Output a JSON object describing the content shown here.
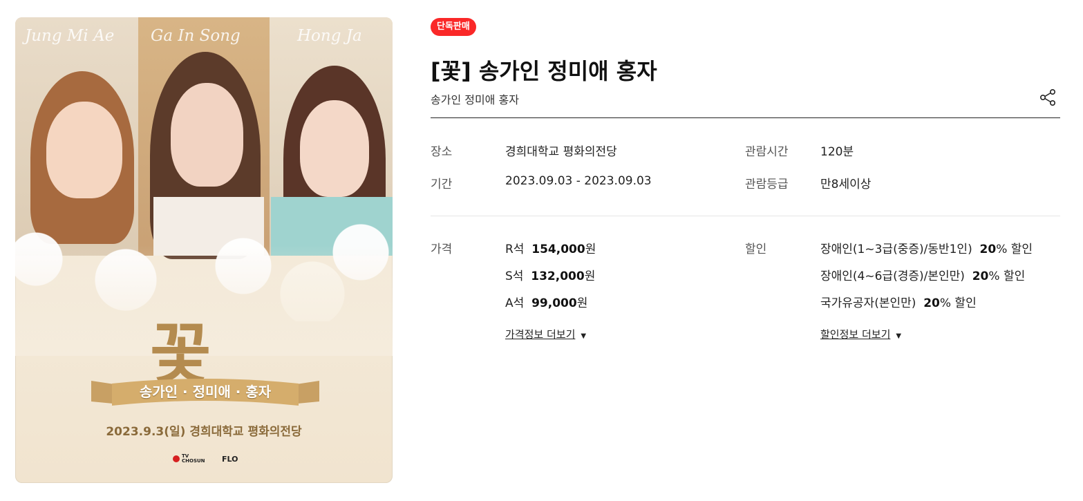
{
  "poster": {
    "signatures": [
      "Jung Mi Ae",
      "Ga In Song",
      "Hong Ja"
    ],
    "big_title": "꽃",
    "ribbon_text": "송가인 · 정미애 · 홍자",
    "date_line": "2023.9.3(일) 경희대학교 평화의전당",
    "logos": [
      "TV CHOSUN",
      "FLO"
    ]
  },
  "product": {
    "badge": "단독판매",
    "title": "[꽃] 송가인 정미애 홍자",
    "subtitle": "송가인 정미애 홍자",
    "share_icon": "share-icon"
  },
  "info": {
    "venue_label": "장소",
    "venue_value": "경희대학교 평화의전당",
    "period_label": "기간",
    "period_value": "2023.09.03 - 2023.09.03",
    "runtime_label": "관람시간",
    "runtime_value": "120분",
    "rating_label": "관람등급",
    "rating_value": "만8세이상"
  },
  "price": {
    "label": "가격",
    "items": [
      {
        "grade": "R석",
        "amount": "154,000",
        "unit": "원"
      },
      {
        "grade": "S석",
        "amount": "132,000",
        "unit": "원"
      },
      {
        "grade": "A석",
        "amount": "99,000",
        "unit": "원"
      }
    ],
    "more_label": "가격정보 더보기"
  },
  "discount": {
    "label": "할인",
    "items": [
      {
        "name": "장애인(1~3급(중증)/동반1인)",
        "rate": "20",
        "suffix": "% 할인"
      },
      {
        "name": "장애인(4~6급(경증)/본인만)",
        "rate": "20",
        "suffix": "% 할인"
      },
      {
        "name": "국가유공자(본인만)",
        "rate": "20",
        "suffix": "% 할인"
      }
    ],
    "more_label": "할인정보 더보기"
  },
  "colors": {
    "badge_bg": "#fa2828",
    "poster_gold": "#b48b4f"
  }
}
